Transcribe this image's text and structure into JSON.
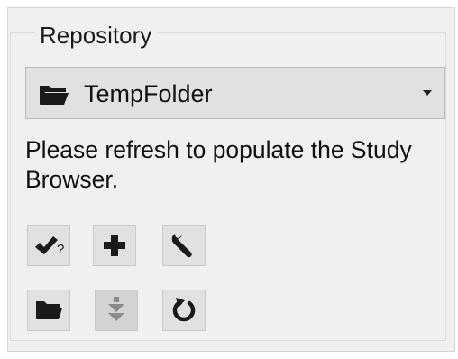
{
  "group": {
    "title": "Repository"
  },
  "repository_select": {
    "icon": "folder-open-icon",
    "selected": "TempFolder"
  },
  "message": "Please refresh to populate the Study Browser.",
  "toolbar": [
    {
      "icon": "check-question-icon",
      "glyph": "?",
      "enabled": true
    },
    {
      "icon": "plus-icon",
      "enabled": true
    },
    {
      "icon": "wrench-icon",
      "enabled": true
    },
    {
      "icon": "folder-open-icon",
      "enabled": true
    },
    {
      "icon": "download-arrows-icon",
      "enabled": false
    },
    {
      "icon": "refresh-icon",
      "enabled": true
    }
  ],
  "colors": {
    "panel_bg": "#f0f0f0",
    "button_bg": "#e1e1e1",
    "disabled_button_bg": "#d3d3d3",
    "icon": "#1a1a1a",
    "disabled_icon": "#8a8a8a"
  }
}
